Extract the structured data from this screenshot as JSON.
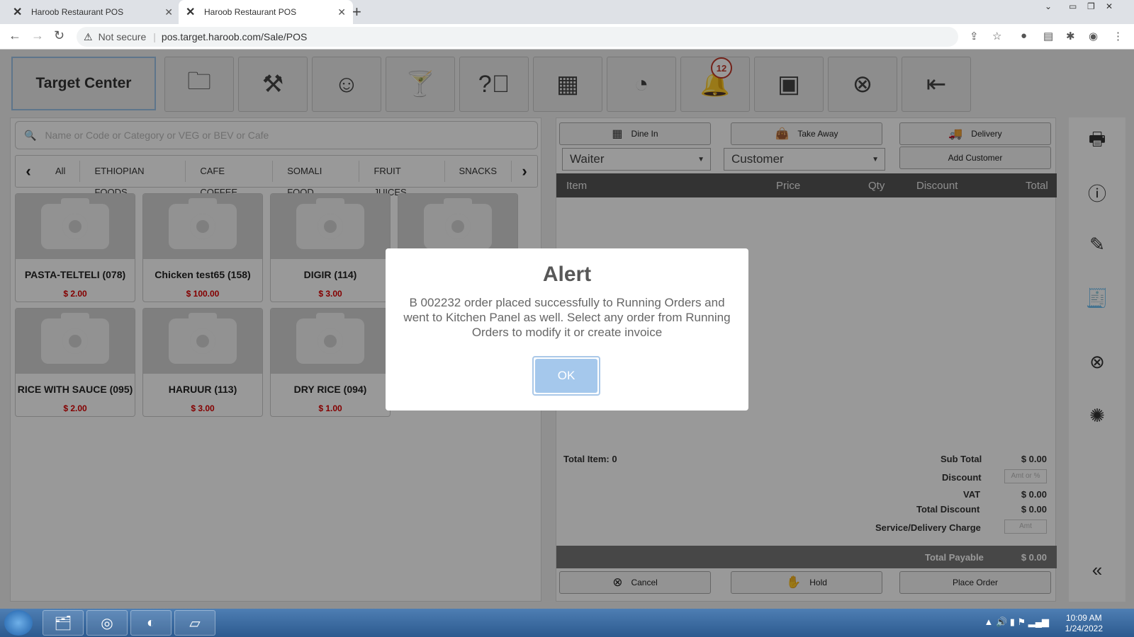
{
  "browser": {
    "tabs": [
      {
        "title": "Haroob Restaurant POS",
        "favicon": "x-logo"
      },
      {
        "title": "Haroob Restaurant POS",
        "favicon": "x-logo"
      }
    ],
    "security_label": "Not secure",
    "url": "pos.target.haroob.com/Sale/POS"
  },
  "app": {
    "brand": "Target Center",
    "toolbar_icons": [
      "folder-icon",
      "kitchen-icon",
      "waiter-icon",
      "bar-drink-icon",
      "help-icon",
      "calculator-icon",
      "timer-icon",
      "bell-icon",
      "dashboard-icon",
      "close-icon",
      "logout-icon"
    ],
    "notification_count": "12",
    "search_placeholder": "Name or Code or Category or VEG or BEV or Cafe",
    "categories": [
      "All",
      "ETHIOPIAN FOODS",
      "CAFE COFFEE",
      "SOMALI FOOD",
      "FRUIT JUICES",
      "SNACKS"
    ],
    "products": [
      {
        "name": "PASTA-TELTELI (078)",
        "price": "$ 2.00"
      },
      {
        "name": "Chicken test65 (158)",
        "price": "$ 100.00"
      },
      {
        "name": "DIGIR (114)",
        "price": "$ 3.00"
      },
      {
        "name": "",
        "price": ""
      },
      {
        "name": "RICE WITH SAUCE (095)",
        "price": "$ 2.00"
      },
      {
        "name": "HARUUR (113)",
        "price": "$ 3.00"
      },
      {
        "name": "DRY RICE (094)",
        "price": "$ 1.00"
      }
    ],
    "order_types": [
      "Dine In",
      "Take Away",
      "Delivery"
    ],
    "waiter_select": "Waiter",
    "customer_select": "Customer",
    "add_customer": "Add Customer",
    "table_headers": {
      "item": "Item",
      "price": "Price",
      "qty": "Qty",
      "discount": "Discount",
      "total": "Total"
    },
    "totals": {
      "total_item_label": "Total Item: 0",
      "subtotal_label": "Sub Total",
      "subtotal": "$ 0.00",
      "discount_label": "Discount",
      "discount_placeholder": "Amt or %",
      "vat_label": "VAT",
      "vat": "$ 0.00",
      "total_discount_label": "Total Discount",
      "total_discount": "$ 0.00",
      "service_label": "Service/Delivery Charge",
      "service_placeholder": "Amt",
      "payable_label": "Total Payable",
      "payable": "$ 0.00"
    },
    "actions": {
      "cancel": "Cancel",
      "hold": "Hold",
      "place_order": "Place Order"
    }
  },
  "alert": {
    "title": "Alert",
    "message": "B 002232 order placed successfully to Running Orders and went to Kitchen Panel as well. Select any order from Running Orders to modify it or create invoice",
    "ok": "OK"
  },
  "taskbar": {
    "time": "10:09 AM",
    "date": "1/24/2022"
  }
}
